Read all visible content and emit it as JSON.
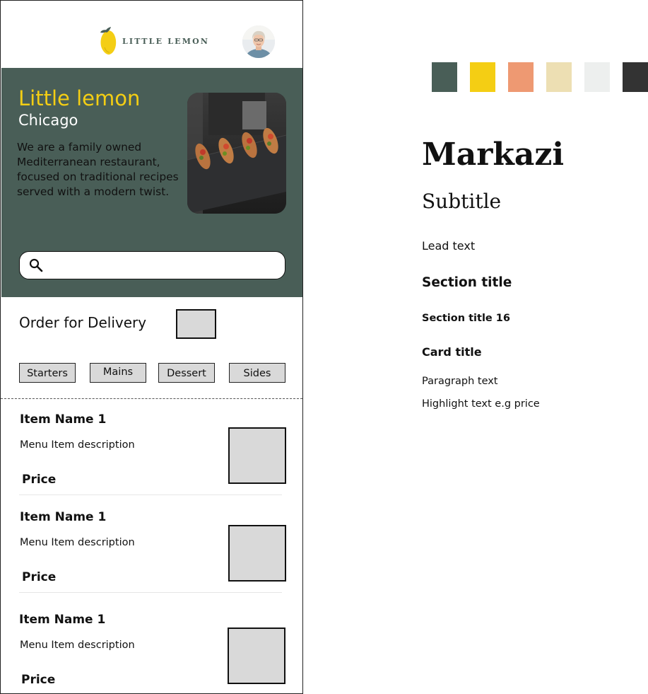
{
  "header": {
    "logo_text": "LITTLE LEMON"
  },
  "hero": {
    "title": "Little lemon",
    "city": "Chicago",
    "description": "We are a family owned Mediterranean restaurant, focused on traditional recipes served with a modern twist.",
    "search_placeholder": ""
  },
  "order": {
    "title": "Order for Delivery",
    "categories": [
      "Starters",
      "Mains",
      "Dessert",
      "Sides"
    ]
  },
  "menu_items": [
    {
      "name": "Item Name 1",
      "description": "Menu Item description",
      "price": "Price"
    },
    {
      "name": "Item Name 1",
      "description": "Menu Item description",
      "price": "Price"
    },
    {
      "name": "Item Name 1",
      "description": "Menu Item description",
      "price": "Price"
    }
  ],
  "style_guide": {
    "colors": [
      "#495E57",
      "#F4CE14",
      "#EE9972",
      "#EDDFB3",
      "#EDEFEE",
      "#333333"
    ],
    "display": "Markazi",
    "subtitle": "Subtitle",
    "lead_text": "Lead text",
    "section_title": "Section title",
    "section_title_16": "Section title 16",
    "card_title": "Card title",
    "paragraph_text": "Paragraph text",
    "highlight_text": "Highlight text e.g price"
  },
  "icons": {
    "logo": "lemon-logo-icon",
    "avatar": "user-avatar",
    "search": "search-icon"
  }
}
